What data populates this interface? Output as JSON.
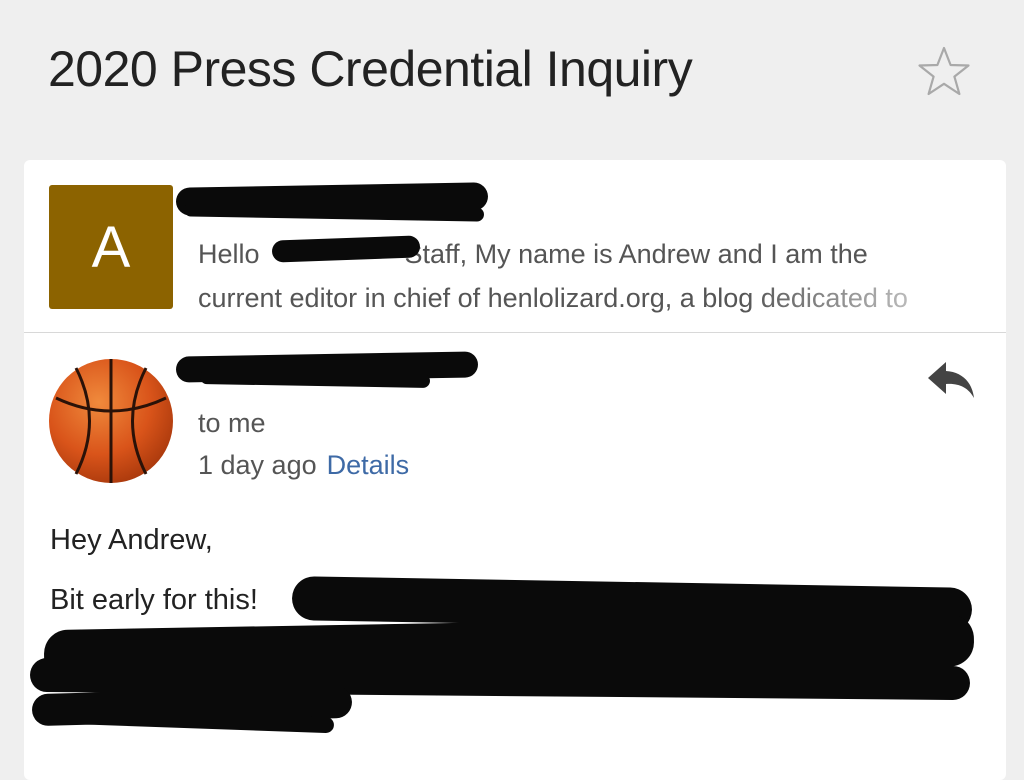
{
  "header": {
    "subject": "2020 Press Credential Inquiry",
    "star_icon": "star-outline-icon"
  },
  "thread": {
    "collapsed_message": {
      "avatar_letter": "A",
      "avatar_color": "#8c6300",
      "snippet_part1": "Hello",
      "snippet_part2": "Staff, My name is Andrew and I am the",
      "snippet_line2": "current editor in chief of henlolizard.org, a blog dedicated to"
    },
    "expanded_message": {
      "avatar_icon": "basketball-icon",
      "reply_icon": "reply-icon",
      "recipient": "to me",
      "time": "1 day ago",
      "details_label": "Details",
      "details_color": "#3e6aa6",
      "body_greeting": "Hey Andrew,",
      "body_line2": "Bit early for this!"
    }
  }
}
